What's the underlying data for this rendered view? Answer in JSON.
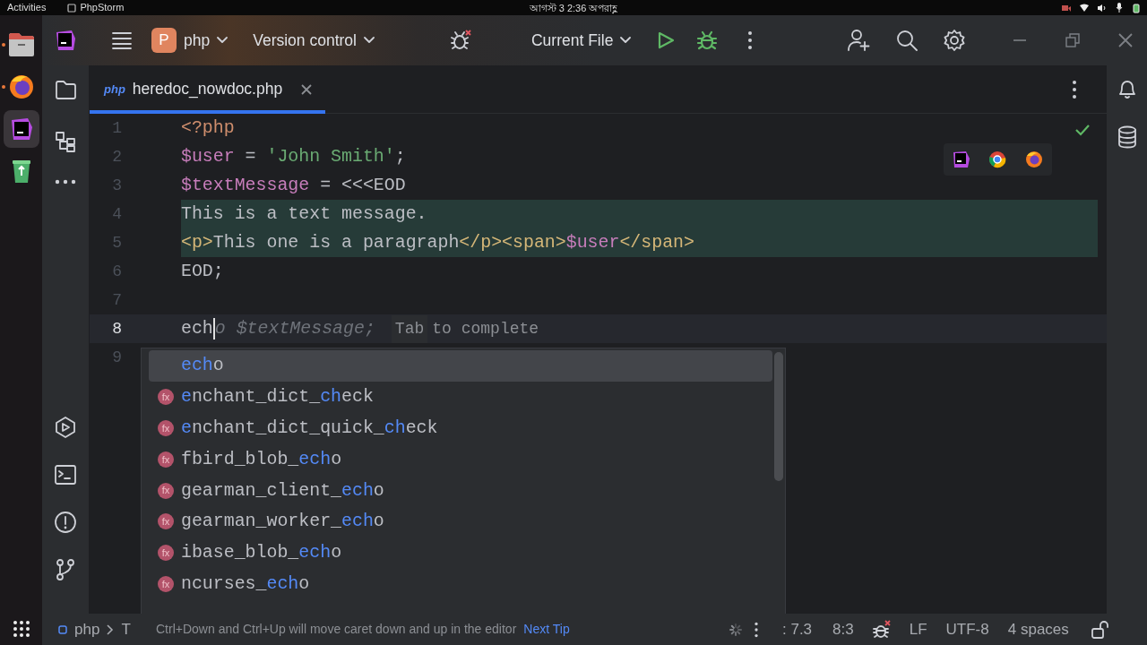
{
  "system_bar": {
    "activities": "Activities",
    "app_name": "PhpStorm",
    "clock": "আগস্ট 3  2:36 অপরাহ্ণ"
  },
  "dock": [
    {
      "kind": "files",
      "running": true,
      "selected": false
    },
    {
      "kind": "browser",
      "running": true,
      "selected": false
    },
    {
      "kind": "ide",
      "running": false,
      "selected": true
    },
    {
      "kind": "recycle",
      "running": false,
      "selected": false
    }
  ],
  "toolbar": {
    "project_initial": "P",
    "project": "php",
    "vcs": "Version control",
    "run_config": "Current File"
  },
  "tabs": [
    {
      "badge": "php",
      "label": "heredoc_nowdoc.php",
      "selected": true
    }
  ],
  "editor": {
    "lines": [
      {
        "number": "1",
        "current": false,
        "highlighted": false,
        "tokens": [
          {
            "kind": "keyword",
            "text": "<?php"
          }
        ]
      },
      {
        "number": "2",
        "current": false,
        "highlighted": false,
        "tokens": [
          {
            "kind": "variable",
            "text": "$user"
          },
          {
            "kind": "text",
            "text": " = "
          },
          {
            "kind": "string",
            "text": "'John Smith'"
          },
          {
            "kind": "text",
            "text": ";"
          }
        ]
      },
      {
        "number": "3",
        "current": false,
        "highlighted": false,
        "tokens": [
          {
            "kind": "variable",
            "text": "$textMessage"
          },
          {
            "kind": "text",
            "text": " = <<<EOD"
          }
        ]
      },
      {
        "number": "4",
        "current": false,
        "highlighted": true,
        "tokens": [
          {
            "kind": "text",
            "text": "This is a text message."
          }
        ]
      },
      {
        "number": "5",
        "current": false,
        "highlighted": true,
        "tokens": [
          {
            "kind": "markup",
            "text": "<p>"
          },
          {
            "kind": "text",
            "text": "This one is a paragraph"
          },
          {
            "kind": "markup",
            "text": "</p><span>"
          },
          {
            "kind": "variable",
            "text": "$user"
          },
          {
            "kind": "markup",
            "text": "</span>"
          }
        ]
      },
      {
        "number": "6",
        "current": false,
        "highlighted": false,
        "tokens": [
          {
            "kind": "text",
            "text": "EOD;"
          }
        ]
      },
      {
        "number": "7",
        "current": false,
        "highlighted": false
      },
      {
        "number": "8",
        "current": true,
        "highlighted": false,
        "tokens": [
          {
            "kind": "text",
            "text": "ech",
            "caret_after": true
          },
          {
            "kind": "ghost",
            "text": "o $textMessage;"
          }
        ],
        "hint": {
          "key": "Tab",
          "text": "to complete"
        }
      },
      {
        "number": "9",
        "current": false,
        "highlighted": false
      }
    ]
  },
  "completion": {
    "items": [
      {
        "kind": "keyword",
        "selected": true,
        "parts": [
          {
            "text": "ech",
            "match": true
          },
          {
            "text": "o",
            "match": false
          }
        ]
      },
      {
        "kind": "function",
        "badge": "fx",
        "selected": false,
        "parts": [
          {
            "text": "e",
            "match": true
          },
          {
            "text": "nchant_dict_",
            "match": false
          },
          {
            "text": "ch",
            "match": true
          },
          {
            "text": "eck",
            "match": false
          }
        ]
      },
      {
        "kind": "function",
        "badge": "fx",
        "selected": false,
        "parts": [
          {
            "text": "e",
            "match": true
          },
          {
            "text": "nchant_dict_quick_",
            "match": false
          },
          {
            "text": "ch",
            "match": true
          },
          {
            "text": "eck",
            "match": false
          }
        ]
      },
      {
        "kind": "function",
        "badge": "fx",
        "selected": false,
        "parts": [
          {
            "text": "fbird_blob_",
            "match": false
          },
          {
            "text": "ech",
            "match": true
          },
          {
            "text": "o",
            "match": false
          }
        ]
      },
      {
        "kind": "function",
        "badge": "fx",
        "selected": false,
        "parts": [
          {
            "text": "gearman_client_",
            "match": false
          },
          {
            "text": "ech",
            "match": true
          },
          {
            "text": "o",
            "match": false
          }
        ]
      },
      {
        "kind": "function",
        "badge": "fx",
        "selected": false,
        "parts": [
          {
            "text": "gearman_worker_",
            "match": false
          },
          {
            "text": "ech",
            "match": true
          },
          {
            "text": "o",
            "match": false
          }
        ]
      },
      {
        "kind": "function",
        "badge": "fx",
        "selected": false,
        "parts": [
          {
            "text": "ibase_blob_",
            "match": false
          },
          {
            "text": "ech",
            "match": true
          },
          {
            "text": "o",
            "match": false
          }
        ]
      },
      {
        "kind": "function",
        "badge": "fx",
        "selected": false,
        "parts": [
          {
            "text": "ncurses_",
            "match": false
          },
          {
            "text": "ech",
            "match": true
          },
          {
            "text": "o",
            "match": false
          }
        ]
      }
    ]
  },
  "status_bar": {
    "breadcrumbs": [
      "php",
      "T"
    ],
    "tip": {
      "text": "Ctrl+Down and Ctrl+Up will move caret down and up in the editor",
      "link": "Next Tip"
    },
    "php_level": ": 7.3",
    "position": "8:3",
    "line_ending": "LF",
    "encoding": "UTF-8",
    "indent": "4 spaces"
  }
}
